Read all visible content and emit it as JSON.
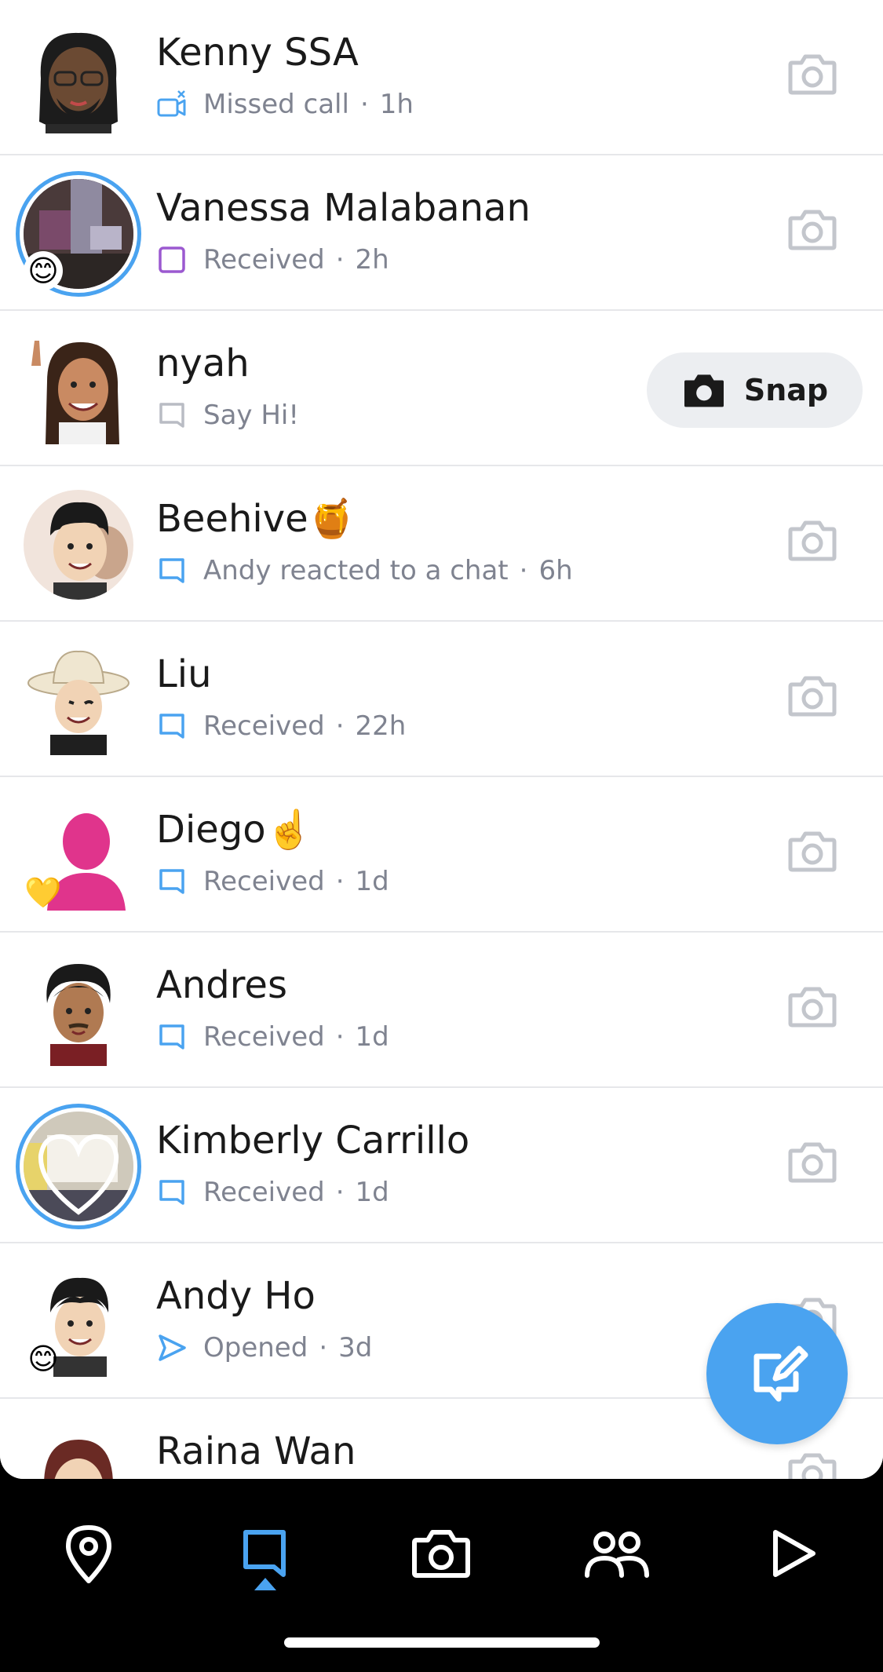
{
  "chats": [
    {
      "name": "Kenny SSA",
      "status_icon": "missed-video-call-icon",
      "status_text": "Missed call",
      "time": "1h",
      "has_story": false,
      "emoji_badge": "",
      "action": "camera"
    },
    {
      "name": "Vanessa Malabanan",
      "status_icon": "received-snap-purple-icon",
      "status_text": "Received",
      "time": "2h",
      "has_story": true,
      "emoji_badge": "😊",
      "action": "camera"
    },
    {
      "name": "nyah",
      "status_icon": "say-hi-chat-icon",
      "status_text": "Say Hi!",
      "time": "",
      "has_story": false,
      "emoji_badge": "",
      "action": "snap"
    },
    {
      "name": "Beehive🍯",
      "status_icon": "chat-bubble-icon",
      "status_text": "Andy reacted to a chat",
      "time": "6h",
      "has_story": false,
      "emoji_badge": "",
      "action": "camera"
    },
    {
      "name": "Liu",
      "status_icon": "chat-bubble-icon",
      "status_text": "Received",
      "time": "22h",
      "has_story": false,
      "emoji_badge": "",
      "action": "camera"
    },
    {
      "name": "Diego☝️",
      "status_icon": "chat-bubble-icon",
      "status_text": "Received",
      "time": "1d",
      "has_story": false,
      "emoji_badge": "💛",
      "action": "camera"
    },
    {
      "name": "Andres",
      "status_icon": "chat-bubble-icon",
      "status_text": "Received",
      "time": "1d",
      "has_story": false,
      "emoji_badge": "",
      "action": "camera"
    },
    {
      "name": "Kimberly Carrillo",
      "status_icon": "chat-bubble-icon",
      "status_text": "Received",
      "time": "1d",
      "has_story": true,
      "emoji_badge": "",
      "action": "camera"
    },
    {
      "name": "Andy Ho",
      "status_icon": "opened-arrow-icon",
      "status_text": "Opened",
      "time": "3d",
      "has_story": false,
      "emoji_badge": "😊",
      "action": "camera"
    },
    {
      "name": "Raina Wan",
      "status_icon": "",
      "status_text": "",
      "time": "",
      "has_story": false,
      "emoji_badge": "",
      "action": "camera"
    }
  ],
  "snap_button_label": "Snap",
  "time_separator": "·",
  "colors": {
    "accent_blue": "#4aa3f0",
    "received_purple": "#9b59d0",
    "say_hi_gray": "#b9bcc4",
    "icon_gray": "#c3c6cc",
    "text_primary": "#1a1a1a",
    "text_secondary": "#7f8390",
    "divider": "#e6e7ea"
  },
  "nav": {
    "items": [
      "map-pin-icon",
      "chat-icon",
      "camera-icon",
      "friends-icon",
      "spotlight-play-icon"
    ],
    "active": "chat-icon"
  }
}
